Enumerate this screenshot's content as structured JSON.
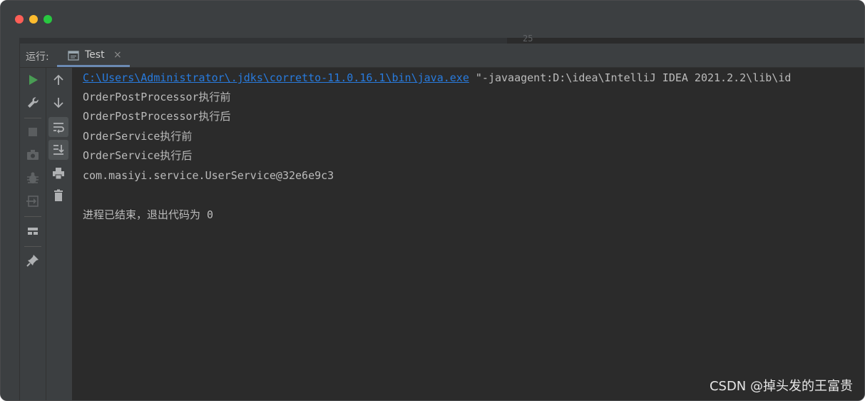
{
  "window": {
    "colors": {
      "background": "#2b2b2b",
      "panel": "#3c3f41",
      "accent": "#6b8ab3",
      "link": "#287bde",
      "run_green": "#499c54"
    }
  },
  "editor": {
    "line_number": "25"
  },
  "run_panel": {
    "label": "运行:",
    "tab": {
      "label": "Test",
      "close_symbol": "×",
      "icon": "console-tab-icon"
    }
  },
  "toolbar_left": [
    {
      "name": "run-icon"
    },
    {
      "name": "wrench-icon"
    },
    {
      "name": "stop-icon"
    },
    {
      "name": "camera-icon"
    },
    {
      "name": "debug-bug-icon"
    },
    {
      "name": "exit-icon"
    },
    {
      "name": "layout-icon"
    },
    {
      "name": "pin-icon"
    }
  ],
  "toolbar_right": [
    {
      "name": "arrow-up-icon"
    },
    {
      "name": "arrow-down-icon"
    },
    {
      "name": "soft-wrap-icon"
    },
    {
      "name": "scroll-to-end-icon"
    },
    {
      "name": "print-icon"
    },
    {
      "name": "trash-icon"
    }
  ],
  "console": {
    "command_path": "C:\\Users\\Administrator\\.jdks\\corretto-11.0.16.1\\bin\\java.exe",
    "command_args": " \"-javaagent:D:\\idea\\IntelliJ IDEA 2021.2.2\\lib\\id",
    "lines": [
      "OrderPostProcessor执行前",
      "OrderPostProcessor执行后",
      "OrderService执行前",
      "OrderService执行后",
      "com.masiyi.service.UserService@32e6e9c3",
      "",
      "进程已结束，退出代码为 0"
    ]
  },
  "watermark": "CSDN @掉头发的王富贵"
}
